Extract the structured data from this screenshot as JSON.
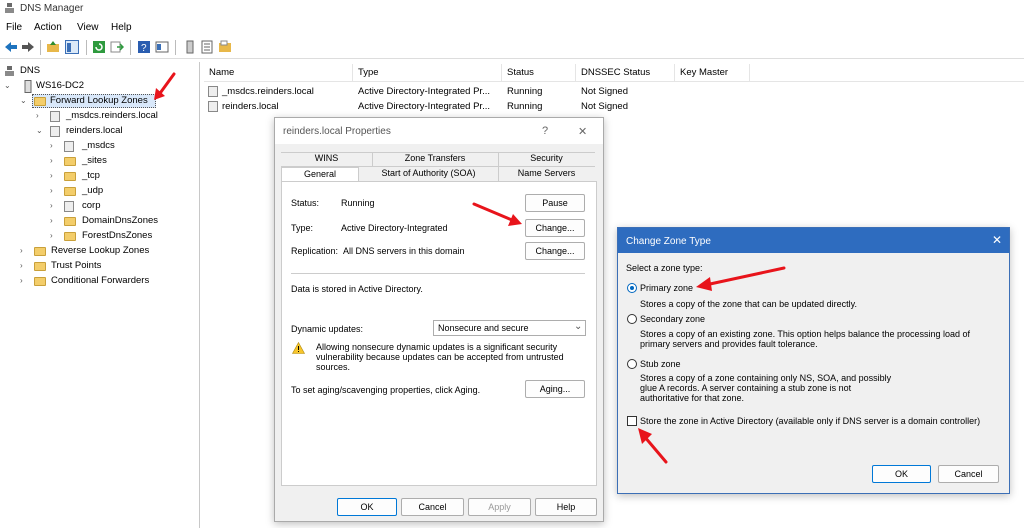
{
  "window": {
    "title": "DNS Manager"
  },
  "menu": [
    "File",
    "Action",
    "View",
    "Help"
  ],
  "tree": {
    "items": [
      {
        "label": "DNS"
      },
      {
        "label": "WS16-DC2"
      },
      {
        "label": "Forward Lookup Zones"
      },
      {
        "label": "_msdcs.reinders.local"
      },
      {
        "label": "reinders.local"
      },
      {
        "label": "_msdcs"
      },
      {
        "label": "_sites"
      },
      {
        "label": "_tcp"
      },
      {
        "label": "_udp"
      },
      {
        "label": "corp"
      },
      {
        "label": "DomainDnsZones"
      },
      {
        "label": "ForestDnsZones"
      },
      {
        "label": "Reverse Lookup Zones"
      },
      {
        "label": "Trust Points"
      },
      {
        "label": "Conditional Forwarders"
      }
    ]
  },
  "list": {
    "columns": [
      "Name",
      "Type",
      "Status",
      "DNSSEC Status",
      "Key Master"
    ],
    "rows": [
      {
        "name": "_msdcs.reinders.local",
        "type": "Active Directory-Integrated Pr...",
        "status": "Running",
        "dnssec": "Not Signed",
        "key": ""
      },
      {
        "name": "reinders.local",
        "type": "Active Directory-Integrated Pr...",
        "status": "Running",
        "dnssec": "Not Signed",
        "key": ""
      }
    ]
  },
  "props": {
    "title": "reinders.local Properties",
    "help_glyph": "?",
    "close_glyph": "✕",
    "tabs_top": [
      "WINS",
      "Zone Transfers",
      "Security"
    ],
    "tabs_bottom": [
      "General",
      "Start of Authority (SOA)",
      "Name Servers"
    ],
    "status_label": "Status:",
    "status_value": "Running",
    "type_label": "Type:",
    "type_value": "Active Directory-Integrated",
    "replication_label": "Replication:",
    "replication_value": "All DNS servers in this domain",
    "pause": "Pause",
    "change": "Change...",
    "stored_text": "Data is stored in Active Directory.",
    "dyn_label": "Dynamic updates:",
    "dyn_value": "Nonsecure and secure",
    "warning": "Allowing nonsecure dynamic updates is a significant security vulnerability because updates can be accepted from untrusted sources.",
    "aging_text": "To set aging/scavenging properties, click Aging.",
    "aging": "Aging...",
    "ok": "OK",
    "cancel": "Cancel",
    "apply": "Apply",
    "help": "Help"
  },
  "czt": {
    "title": "Change Zone Type",
    "close_glyph": "✕",
    "prompt": "Select a zone type:",
    "primary_label": "Primary zone",
    "primary_desc": "Stores a copy of the zone that can be updated directly.",
    "secondary_label": "Secondary zone",
    "secondary_desc": "Stores a copy of an existing zone. This option helps balance the processing load of primary servers and provides fault tolerance.",
    "stub_label": "Stub zone",
    "stub_desc": "Stores a copy of a zone containing only NS, SOA, and possibly glue A records. A server containing a stub zone is not authoritative for that zone.",
    "store_ad": "Store the zone in Active Directory (available only if DNS server is a domain controller)",
    "selected": "Primary zone",
    "store_checked": false,
    "ok": "OK",
    "cancel": "Cancel",
    "accent": "#0067c0"
  },
  "annotation_color": "#e8141b"
}
